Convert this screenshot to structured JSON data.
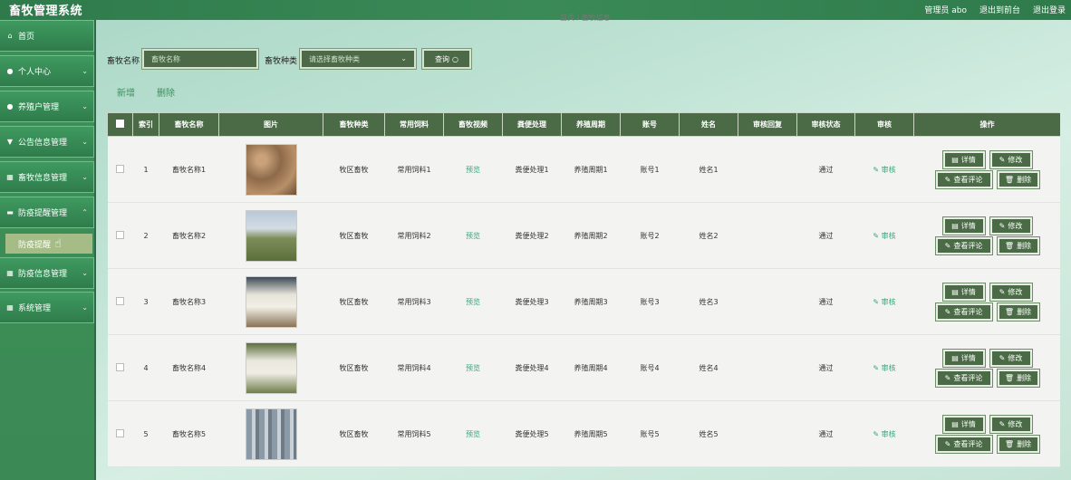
{
  "app": {
    "title": "畜牧管理系统",
    "user_label": "管理员 abo",
    "front_link": "退出到前台",
    "logout": "退出登录",
    "breadcrumb": "首页 / 畜牧信息"
  },
  "sidebar": {
    "items": [
      {
        "label": "首页",
        "icon": "home-icon"
      },
      {
        "label": "个人中心",
        "icon": "user-icon"
      },
      {
        "label": "养殖户管理",
        "icon": "user-icon"
      },
      {
        "label": "公告信息管理",
        "icon": "shield-icon"
      },
      {
        "label": "畜牧信息管理",
        "icon": "grid-icon"
      },
      {
        "label": "防疫提醒管理",
        "icon": "chat-icon"
      },
      {
        "label": "防疫信息管理",
        "icon": "grid-icon"
      },
      {
        "label": "系统管理",
        "icon": "grid-icon"
      }
    ],
    "submenu": "防疫提醒"
  },
  "search": {
    "name_label": "畜牧名称",
    "name_placeholder": "畜牧名称",
    "type_label": "畜牧种类",
    "type_placeholder": "请选择畜牧种类",
    "query_label": "查询"
  },
  "actions": {
    "add": "新增",
    "delete": "删除"
  },
  "table": {
    "headers": [
      "索引",
      "畜牧名称",
      "图片",
      "畜牧种类",
      "常用饲料",
      "畜牧视频",
      "粪便处理",
      "养殖周期",
      "账号",
      "姓名",
      "审核回复",
      "审核状态",
      "审核",
      "操作"
    ],
    "buttons": {
      "detail": "详情",
      "edit": "修改",
      "comments": "查看评论",
      "delete": "删除"
    },
    "rows": [
      {
        "index": "1",
        "name": "畜牧名称1",
        "type": "牧区畜牧",
        "feed": "常用饲料1",
        "video": "预览",
        "waste": "粪便处理1",
        "cycle": "养殖周期1",
        "account": "账号1",
        "person": "姓名1",
        "reply": "",
        "status": "通过",
        "review": "审核"
      },
      {
        "index": "2",
        "name": "畜牧名称2",
        "type": "牧区畜牧",
        "feed": "常用饲料2",
        "video": "预览",
        "waste": "粪便处理2",
        "cycle": "养殖周期2",
        "account": "账号2",
        "person": "姓名2",
        "reply": "",
        "status": "通过",
        "review": "审核"
      },
      {
        "index": "3",
        "name": "畜牧名称3",
        "type": "牧区畜牧",
        "feed": "常用饲料3",
        "video": "预览",
        "waste": "粪便处理3",
        "cycle": "养殖周期3",
        "account": "账号3",
        "person": "姓名3",
        "reply": "",
        "status": "通过",
        "review": "审核"
      },
      {
        "index": "4",
        "name": "畜牧名称4",
        "type": "牧区畜牧",
        "feed": "常用饲料4",
        "video": "预览",
        "waste": "粪便处理4",
        "cycle": "养殖周期4",
        "account": "账号4",
        "person": "姓名4",
        "reply": "",
        "status": "通过",
        "review": "审核"
      },
      {
        "index": "5",
        "name": "畜牧名称5",
        "type": "牧区畜牧",
        "feed": "常用饲料5",
        "video": "预览",
        "waste": "粪便处理5",
        "cycle": "养殖周期5",
        "account": "账号5",
        "person": "姓名5",
        "reply": "",
        "status": "通过",
        "review": "审核"
      }
    ]
  },
  "colors": {
    "header_green": "#2f7a4b",
    "button_dark": "#4a6b46",
    "accent_teal": "#3aa57a"
  }
}
